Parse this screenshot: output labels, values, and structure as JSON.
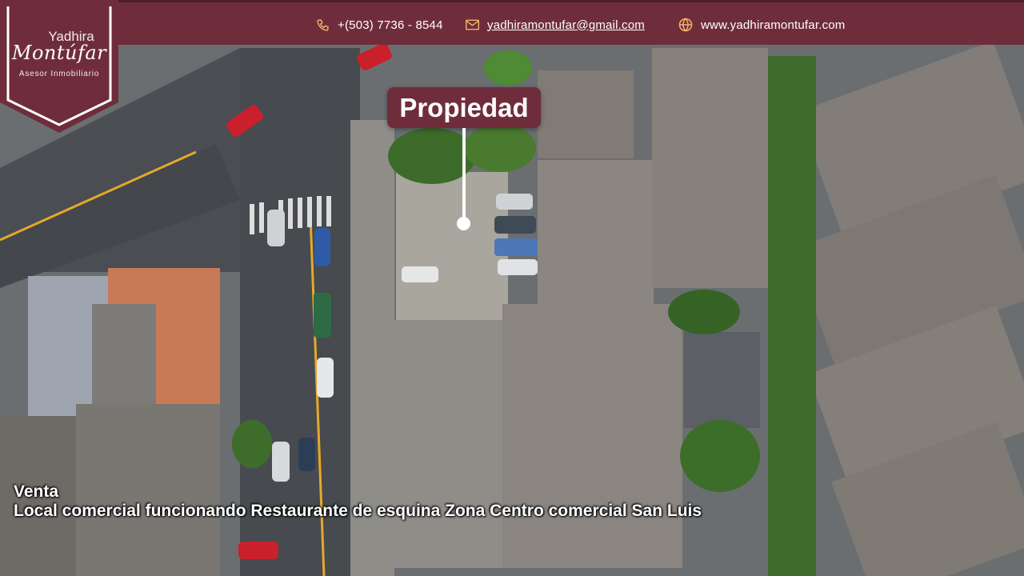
{
  "contact": {
    "phone": "+(503) 7736 - 8544",
    "email": "yadhiramontufar@gmail.com",
    "website": "www.yadhiramontufar.com"
  },
  "logo": {
    "first_name": "Yadhira",
    "last_name": "Montúfar",
    "subtitle": "Asesor Inmobiliario"
  },
  "marker": {
    "label": "Propiedad"
  },
  "caption": {
    "kind": "Venta",
    "title": "Local comercial funcionando Restaurante de esquina Zona Centro comercial San Luis"
  },
  "colors": {
    "brand": "#6f2d3c",
    "icon_accent": "#f2b36b",
    "text": "#ffffff"
  },
  "icons": {
    "phone": "phone-icon",
    "email": "envelope-icon",
    "website": "globe-icon"
  }
}
